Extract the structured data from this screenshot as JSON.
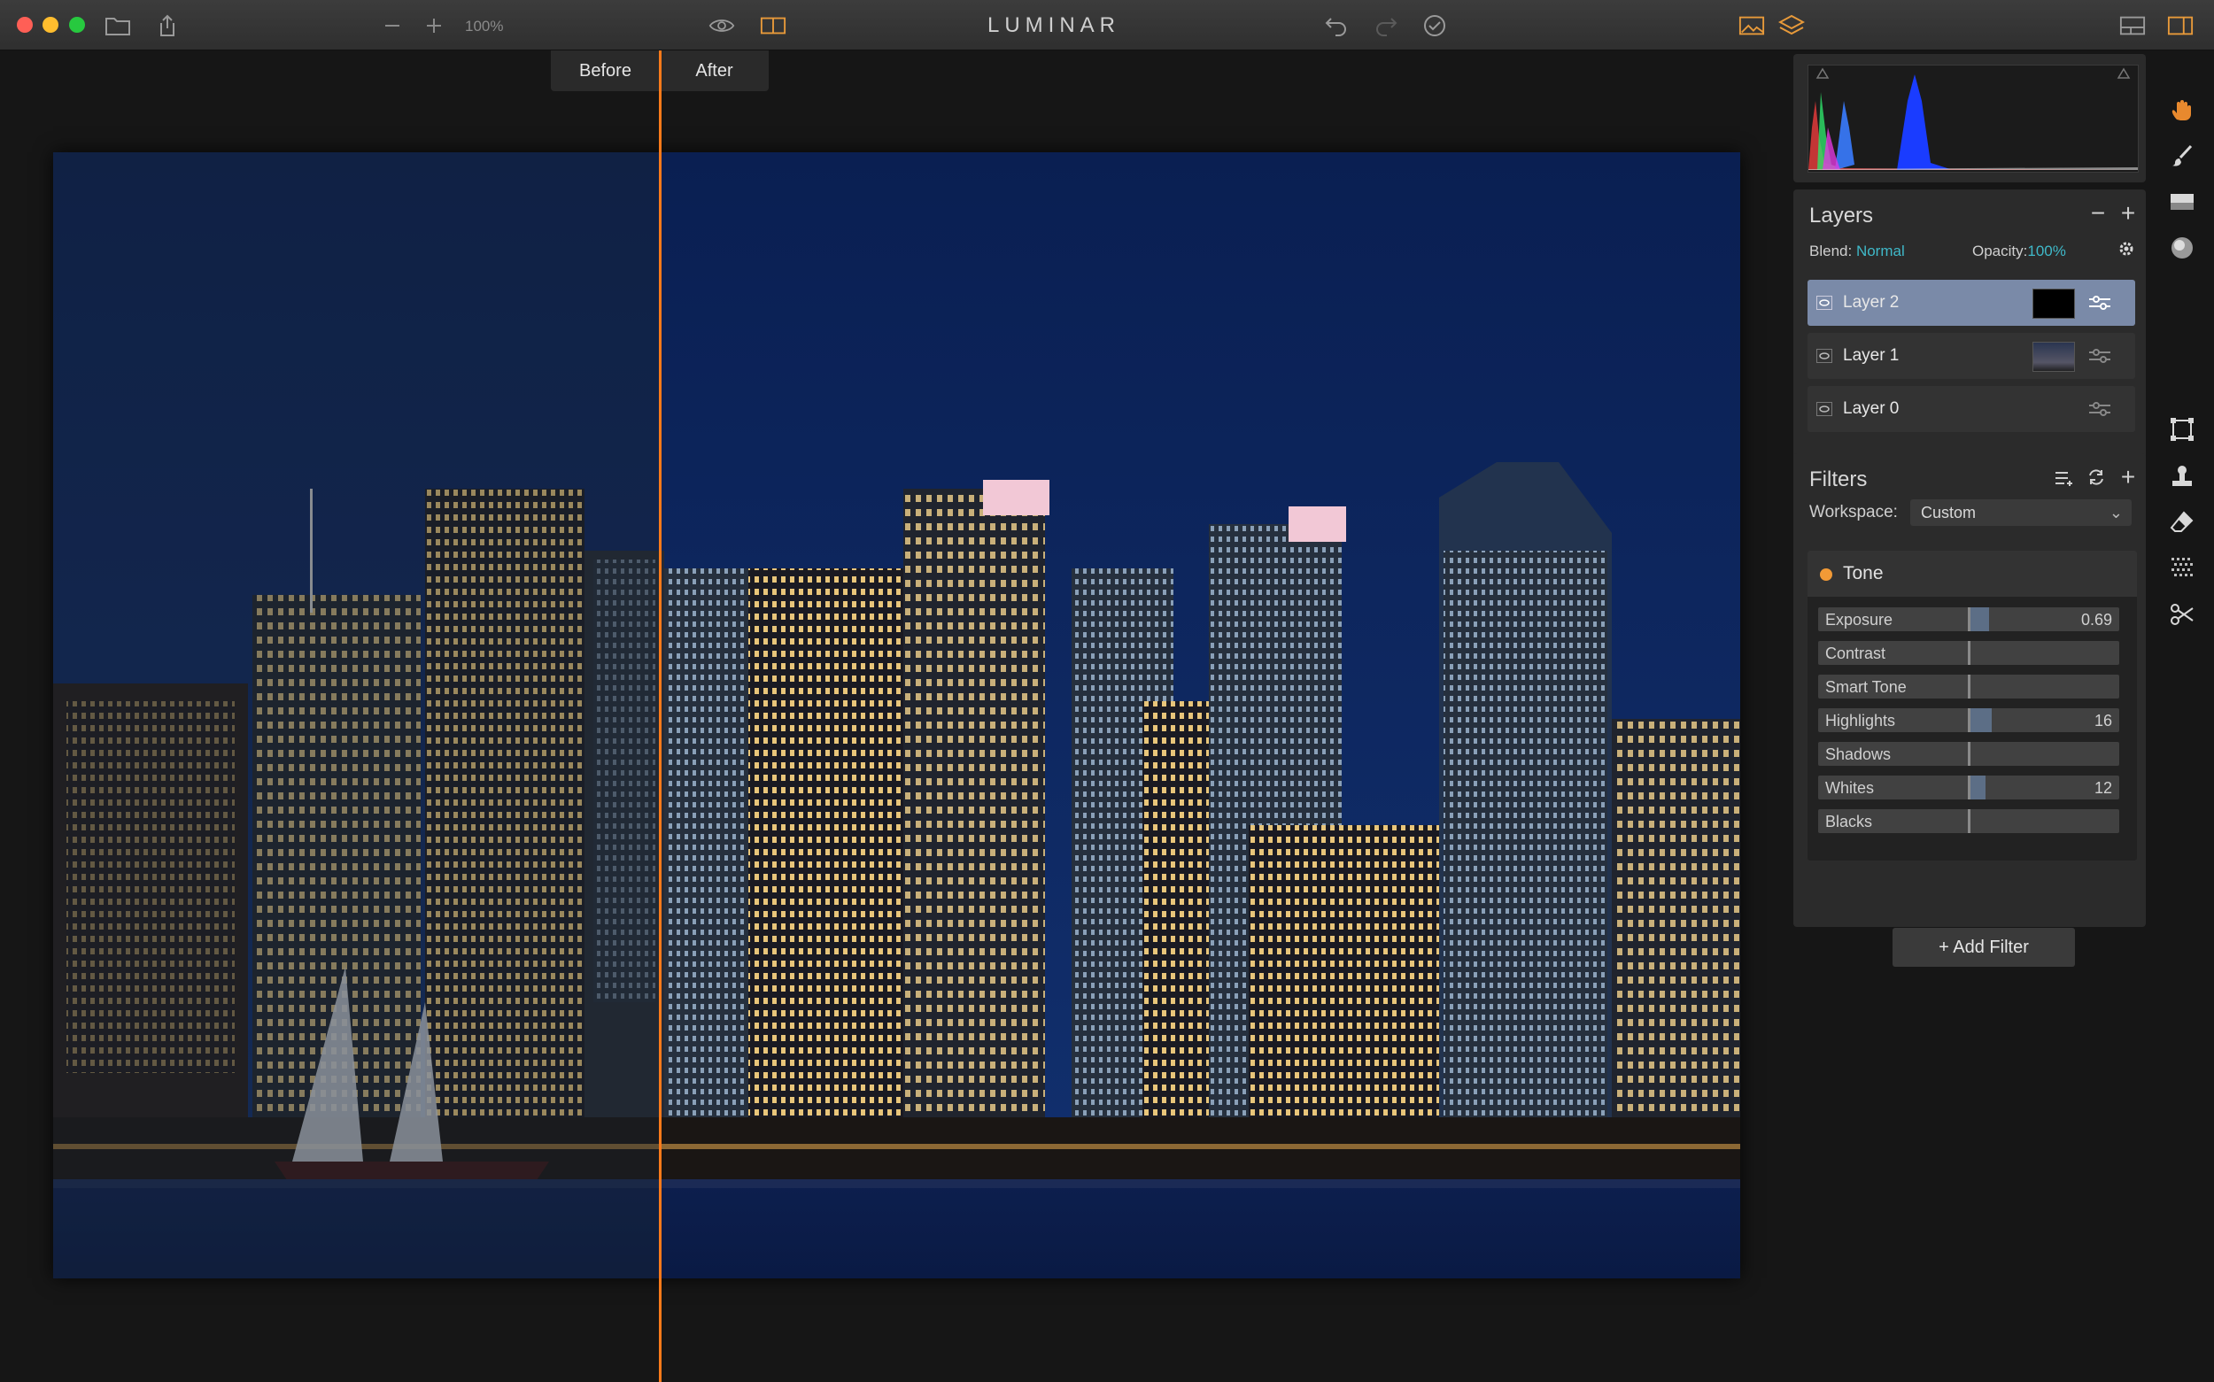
{
  "app": {
    "title": "LUMINAR",
    "zoom": "100%"
  },
  "toolbar": {
    "icons": [
      "close",
      "minimize",
      "maximize",
      "folder-icon",
      "share-icon",
      "zoom-out-icon",
      "zoom-in-icon",
      "eye-icon",
      "compare-icon",
      "undo-icon",
      "redo-icon",
      "check-icon",
      "image-icon",
      "layers-icon",
      "layout-icon",
      "sidebar-icon"
    ]
  },
  "compare": {
    "before_label": "Before",
    "after_label": "After",
    "split_color": "#ff7a1a"
  },
  "layers": {
    "title": "Layers",
    "blend_label": "Blend:",
    "blend_value": "Normal",
    "opacity_label": "Opacity:",
    "opacity_value": "100%",
    "items": [
      {
        "name": "Layer 2",
        "selected": true
      },
      {
        "name": "Layer 1",
        "selected": false
      },
      {
        "name": "Layer 0",
        "selected": false
      }
    ]
  },
  "filters": {
    "title": "Filters",
    "workspace_label": "Workspace:",
    "workspace_value": "Custom",
    "tone": {
      "title": "Tone",
      "sliders": [
        {
          "label": "Exposure",
          "value": "0.69"
        },
        {
          "label": "Contrast",
          "value": ""
        },
        {
          "label": "Smart Tone",
          "value": ""
        },
        {
          "label": "Highlights",
          "value": "16"
        },
        {
          "label": "Shadows",
          "value": ""
        },
        {
          "label": "Whites",
          "value": "12"
        },
        {
          "label": "Blacks",
          "value": ""
        }
      ]
    },
    "add_filter_label": "Add Filter"
  },
  "tools": [
    "hand-icon",
    "brush-icon",
    "gradient-icon",
    "radial-icon",
    "crop-icon",
    "clone-stamp-icon",
    "eraser-icon",
    "noise-icon",
    "cut-icon"
  ],
  "colors": {
    "accent": "#3fb8c8",
    "tone_dot": "#f29a36",
    "selected_layer": "#7a8aa8"
  }
}
